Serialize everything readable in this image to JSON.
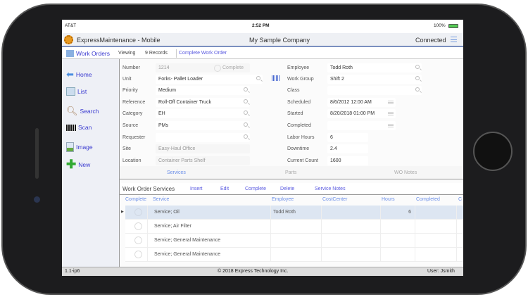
{
  "status_bar": {
    "carrier": "AT&T",
    "time": "2:52 PM",
    "battery": "100%"
  },
  "app": {
    "title": "ExpressMaintenance - Mobile",
    "company": "My Sample Company",
    "connection": "Connected"
  },
  "subheader": {
    "module": "Work Orders",
    "viewing_label": "Viewing",
    "records": "9 Records",
    "action": "Complete Work Order"
  },
  "sidebar": {
    "items": [
      {
        "label": "Home",
        "icon": "arrow-left-icon"
      },
      {
        "label": "List",
        "icon": "list-icon"
      },
      {
        "label": "Search",
        "icon": "magnifier-icon"
      },
      {
        "label": "Scan",
        "icon": "barcode-icon"
      },
      {
        "label": "Image",
        "icon": "image-icon"
      },
      {
        "label": "New",
        "icon": "plus-icon"
      }
    ]
  },
  "form": {
    "left": [
      {
        "label": "Number",
        "value": "1214"
      },
      {
        "label": "Unit",
        "value": "Forks- Pallet Loader"
      },
      {
        "label": "Priority",
        "value": "Medium"
      },
      {
        "label": "Reference",
        "value": "Roll-Off Container Truck"
      },
      {
        "label": "Category",
        "value": "EH"
      },
      {
        "label": "Source",
        "value": "PMs"
      },
      {
        "label": "Requester",
        "value": ""
      },
      {
        "label": "Site",
        "value": "Easy-Haul Office"
      },
      {
        "label": "Location",
        "value": "Container Parts Shelf"
      }
    ],
    "complete_label": "Complete",
    "right": [
      {
        "label": "Employee",
        "value": "Todd Roth"
      },
      {
        "label": "Work Group",
        "value": "Shift 2"
      },
      {
        "label": "Class",
        "value": ""
      },
      {
        "label": "Scheduled",
        "value": "8/6/2012 12:00 AM"
      },
      {
        "label": "Started",
        "value": "8/20/2018 01:00 PM"
      },
      {
        "label": "Completed",
        "value": ""
      },
      {
        "label": "Labor Hours",
        "value": "6"
      },
      {
        "label": "Downtime",
        "value": "2.4"
      },
      {
        "label": "Current Count",
        "value": "1600"
      }
    ]
  },
  "tabs": [
    "Services",
    "Parts",
    "WO Notes"
  ],
  "services": {
    "title": "Work Order Services",
    "actions": [
      "Insert",
      "Edit",
      "Complete",
      "Delete",
      "Service Notes"
    ],
    "columns": [
      "Complete",
      "Service",
      "Employee",
      "CostCenter",
      "Hours",
      "Completed",
      "C"
    ],
    "rows": [
      {
        "service": "Service; Oil",
        "employee": "Todd Roth",
        "hours": "6"
      },
      {
        "service": "Service; Air Filter",
        "employee": "",
        "hours": ""
      },
      {
        "service": "Service; General Maintenance",
        "employee": "",
        "hours": ""
      },
      {
        "service": "Service; General Maintenance",
        "employee": "",
        "hours": ""
      }
    ]
  },
  "footer": {
    "version": "1.1-ip6",
    "copyright": "© 2018 Express Technology Inc.",
    "user": "User: Jsmith"
  },
  "colors": {
    "link": "#5a5ae0",
    "accent_border": "#7a8fbf"
  }
}
